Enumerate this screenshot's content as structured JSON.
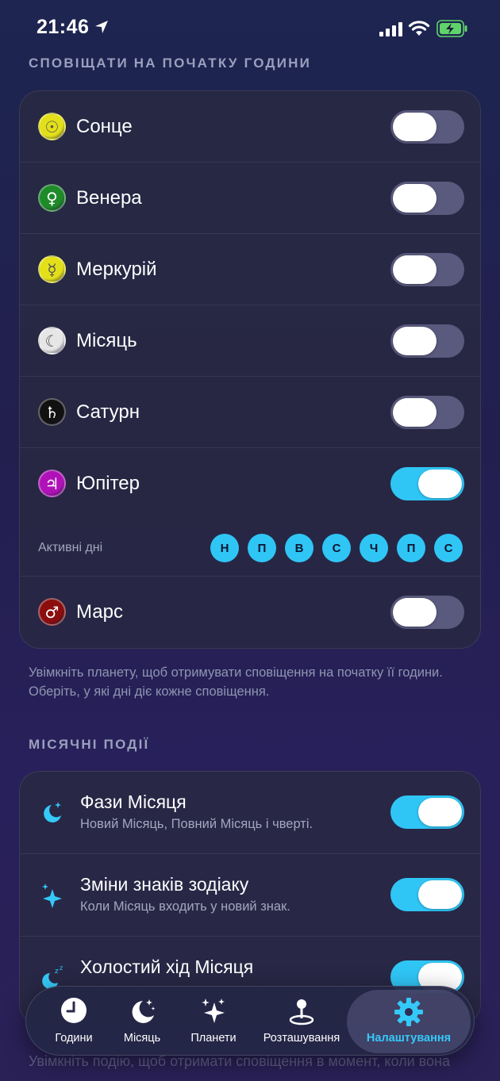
{
  "status": {
    "time": "21:46"
  },
  "hourly_section": {
    "title": "СПОВІЩАТИ НА ПОЧАТКУ ГОДИНИ",
    "planets": [
      {
        "name": "Сонце",
        "symbol": "☉",
        "color": "#e3e01a",
        "on": false
      },
      {
        "name": "Венера",
        "symbol": "♀",
        "color": "#1f8a2a",
        "on": false
      },
      {
        "name": "Меркурій",
        "symbol": "☿",
        "color": "#e3e01a",
        "on": false
      },
      {
        "name": "Місяць",
        "symbol": "☾",
        "color": "#e6e6e6",
        "on": false
      },
      {
        "name": "Сатурн",
        "symbol": "♄",
        "color": "#111111",
        "on": false
      },
      {
        "name": "Юпітер",
        "symbol": "♃",
        "color": "#b012b8",
        "on": true
      }
    ],
    "active_days_label": "Активні дні",
    "days": [
      "Н",
      "П",
      "В",
      "С",
      "Ч",
      "П",
      "С"
    ],
    "planet_after": {
      "name": "Марс",
      "symbol": "♂",
      "color": "#8b0d0d",
      "on": false
    },
    "footnote": "Увімкніть планету, щоб отримувати сповіщення на початку її години. Оберіть, у які дні діє кожне сповіщення."
  },
  "lunar_section": {
    "title": "МІСЯЧНІ ПОДІЇ",
    "events": [
      {
        "title": "Фази Місяця",
        "subtitle": "Новий Місяць, Повний Місяць і чверті.",
        "icon": "moon-stars-icon",
        "on": true
      },
      {
        "title": "Зміни знаків зодіаку",
        "subtitle": "Коли Місяць входить у новий знак.",
        "icon": "sparkles-icon",
        "on": true
      },
      {
        "title": "Холостий хід Місяця",
        "subtitle": "",
        "icon": "moon-zzz-icon",
        "on": true
      }
    ],
    "footnote_partial": "Увімкніть подію, щоб отримати сповіщення в момент, коли вона"
  },
  "tabs": [
    {
      "label": "Години",
      "icon": "clock-icon",
      "active": false
    },
    {
      "label": "Місяць",
      "icon": "moon-stars-icon",
      "active": false
    },
    {
      "label": "Планети",
      "icon": "sparkles-icon",
      "active": false
    },
    {
      "label": "Розташування",
      "icon": "location-pin-icon",
      "active": false
    },
    {
      "label": "Налаштування",
      "icon": "gear-icon",
      "active": true
    }
  ],
  "colors": {
    "accent": "#2fc6f6",
    "toggle_off": "#5a5a7e"
  }
}
